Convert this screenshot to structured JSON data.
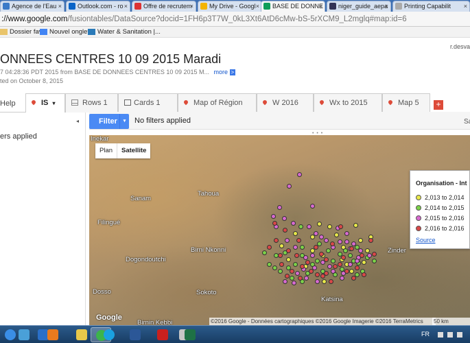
{
  "browser": {
    "tabs": [
      {
        "label": "Agence de l'Eau",
        "fav": "#3a7ac8",
        "active": false
      },
      {
        "label": "Outlook.com - ro",
        "fav": "#0a64c8",
        "active": false
      },
      {
        "label": "Offre de recrutem",
        "fav": "#d33",
        "active": false
      },
      {
        "label": "My Drive - Googl",
        "fav": "#f4b400",
        "active": false
      },
      {
        "label": "BASE DE DONNE",
        "fav": "#0f9d58",
        "active": true
      },
      {
        "label": "niger_guide_aepa",
        "fav": "#335",
        "active": false
      },
      {
        "label": "Printing Capabilit",
        "fav": "#aaa",
        "active": false
      }
    ],
    "close_glyph": "×",
    "address_host": "://www.google.com",
    "address_rest": "/fusiontables/DataSource?docid=1FH6p3T7W_0kL3Xt6AtD6cMw-bS-5rXCM9_L2mglq#map:id=6",
    "bookmarks": [
      {
        "label": "Dossier fav",
        "color": "#e9c46a"
      },
      {
        "label": "Nouvel onglet",
        "color": "#4285f4"
      },
      {
        "label": "Water & Sanitation |...",
        "color": "#2a7ab8"
      }
    ]
  },
  "header": {
    "user": "r.desva",
    "title": "ONNEES CENTRES 10 09 2015 Maradi",
    "meta": "7 04:28:36 PDT 2015 from BASE DE DONNEES CENTRES 10 09 2015 M...",
    "more": "more",
    "more_arrow": ">",
    "edited": "ted on October 8, 2015"
  },
  "tabs": {
    "help": "Help",
    "active_tab": "IS",
    "active_caret": "▾",
    "items": [
      "Rows 1",
      "Cards 1",
      "Map of Région",
      "W 2016",
      "Wx to 2015",
      "Map 5"
    ],
    "add": "+"
  },
  "filters": {
    "button": "Filter",
    "caret": "▾",
    "status": "No filters applied",
    "left_status": "ers applied",
    "right_cut": "Sa",
    "collapse": "◂",
    "resize": "• • •"
  },
  "map": {
    "types": [
      "Plan",
      "Satellite"
    ],
    "selected_type": "Satellite",
    "labels": [
      "Inekar",
      "Tahoua",
      "Sanam",
      "Filingué",
      "Dogondoutchi",
      "Birni Nkonni",
      "Dosso",
      "Sokoto",
      "Katsina",
      "Birnin Kebbi",
      "Zinder"
    ],
    "attribution": "©2016 Google - Données cartographiques ©2016 Google Imagerie ©2016 TerraMetrics",
    "scale": "50 km",
    "google": "Google"
  },
  "legend": {
    "title": "Organisation - Int",
    "items": [
      {
        "label": "2,013 to 2,014",
        "color": "#e8e84a"
      },
      {
        "label": "2,014 to 2,015",
        "color": "#7cd148"
      },
      {
        "label": "2,015 to 2,016",
        "color": "#d86ad0"
      },
      {
        "label": "2,016 to 2,016",
        "color": "#d94848"
      }
    ],
    "source": "Source"
  },
  "points": {
    "yellow": [
      [
        480,
        330
      ],
      [
        430,
        340
      ],
      [
        455,
        345
      ],
      [
        500,
        360
      ],
      [
        525,
        350
      ],
      [
        470,
        372
      ],
      [
        445,
        388
      ],
      [
        498,
        378
      ],
      [
        512,
        395
      ],
      [
        535,
        365
      ],
      [
        410,
        358
      ],
      [
        465,
        326
      ],
      [
        490,
        342
      ],
      [
        518,
        328
      ],
      [
        472,
        410
      ],
      [
        505,
        385
      ],
      [
        530,
        382
      ],
      [
        420,
        378
      ],
      [
        455,
        365
      ],
      [
        540,
        345
      ]
    ],
    "green": [
      [
        440,
        372
      ],
      [
        455,
        385
      ],
      [
        470,
        395
      ],
      [
        485,
        380
      ],
      [
        498,
        392
      ],
      [
        510,
        372
      ],
      [
        522,
        383
      ],
      [
        535,
        375
      ],
      [
        430,
        385
      ],
      [
        415,
        368
      ],
      [
        402,
        372
      ],
      [
        392,
        385
      ],
      [
        408,
        395
      ],
      [
        425,
        405
      ],
      [
        448,
        398
      ],
      [
        462,
        380
      ],
      [
        478,
        365
      ],
      [
        495,
        370
      ],
      [
        515,
        380
      ],
      [
        528,
        395
      ],
      [
        545,
        380
      ],
      [
        488,
        400
      ],
      [
        400,
        390
      ],
      [
        420,
        390
      ],
      [
        440,
        360
      ],
      [
        465,
        355
      ],
      [
        503,
        365
      ],
      [
        520,
        360
      ],
      [
        385,
        368
      ],
      [
        438,
        330
      ],
      [
        520,
        400
      ],
      [
        440,
        410
      ]
    ],
    "purple": [
      [
        436,
        254
      ],
      [
        421,
        271
      ],
      [
        455,
        300
      ],
      [
        407,
        302
      ],
      [
        414,
        318
      ],
      [
        427,
        325
      ],
      [
        450,
        330
      ],
      [
        460,
        340
      ],
      [
        475,
        350
      ],
      [
        485,
        360
      ],
      [
        495,
        352
      ],
      [
        505,
        340
      ],
      [
        515,
        355
      ],
      [
        525,
        365
      ],
      [
        538,
        372
      ],
      [
        430,
        360
      ],
      [
        445,
        375
      ],
      [
        458,
        390
      ],
      [
        470,
        382
      ],
      [
        485,
        395
      ],
      [
        498,
        405
      ],
      [
        510,
        385
      ],
      [
        522,
        375
      ],
      [
        402,
        330
      ],
      [
        398,
        315
      ],
      [
        418,
        350
      ],
      [
        433,
        398
      ],
      [
        446,
        405
      ],
      [
        462,
        410
      ],
      [
        480,
        388
      ],
      [
        500,
        398
      ],
      [
        505,
        352
      ],
      [
        510,
        362
      ],
      [
        520,
        380
      ],
      [
        415,
        410
      ],
      [
        428,
        412
      ],
      [
        455,
        372
      ],
      [
        468,
        345
      ],
      [
        492,
        332
      ],
      [
        442,
        392
      ]
    ],
    "red": [
      [
        400,
        325
      ],
      [
        415,
        335
      ],
      [
        402,
        350
      ],
      [
        420,
        365
      ],
      [
        432,
        372
      ],
      [
        448,
        382
      ],
      [
        462,
        400
      ],
      [
        475,
        378
      ],
      [
        488,
        388
      ],
      [
        500,
        375
      ],
      [
        512,
        362
      ],
      [
        527,
        372
      ],
      [
        540,
        350
      ],
      [
        410,
        385
      ],
      [
        425,
        395
      ],
      [
        437,
        405
      ],
      [
        453,
        395
      ],
      [
        468,
        370
      ],
      [
        484,
        355
      ],
      [
        496,
        330
      ],
      [
        520,
        390
      ],
      [
        530,
        400
      ],
      [
        545,
        370
      ],
      [
        482,
        410
      ],
      [
        470,
        402
      ],
      [
        392,
        360
      ],
      [
        408,
        372
      ],
      [
        440,
        388
      ],
      [
        495,
        385
      ],
      [
        505,
        395
      ],
      [
        460,
        360
      ],
      [
        475,
        398
      ],
      [
        515,
        405
      ],
      [
        435,
        350
      ],
      [
        418,
        402
      ]
    ]
  },
  "taskbar": {
    "apps": [
      {
        "name": "start",
        "color": "#3a8ee6"
      },
      {
        "name": "explorer",
        "color": "#4aa0d8"
      },
      {
        "name": "outlook",
        "color": "#2a6fc8"
      },
      {
        "name": "media",
        "color": "#e87a1e"
      },
      {
        "name": "folder",
        "color": "#e8c84a"
      },
      {
        "name": "chrome",
        "color": "#3cb44b"
      },
      {
        "name": "skype",
        "color": "#1aa1e1"
      },
      {
        "name": "word",
        "color": "#2b5797"
      },
      {
        "name": "acrobat",
        "color": "#c8201e"
      },
      {
        "name": "paint",
        "color": "#c6c6c6"
      },
      {
        "name": "excel",
        "color": "#1e7145"
      }
    ],
    "lang": "FR"
  }
}
